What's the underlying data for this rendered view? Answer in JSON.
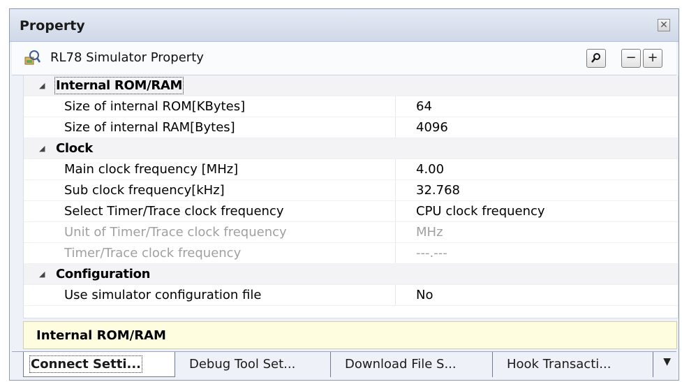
{
  "window": {
    "title": "Property"
  },
  "header": {
    "title": "RL78 Simulator Property",
    "icons": [
      "property-icon",
      "search-icon",
      "collapse-icon",
      "expand-icon"
    ]
  },
  "toolbar": {
    "search_glyph": "🔍",
    "collapse_glyph": "−",
    "expand_glyph": "+"
  },
  "categories": [
    {
      "label": "Internal ROM/RAM",
      "properties": [
        {
          "name": "Size of internal ROM[KBytes]",
          "value": "64"
        },
        {
          "name": "Size of internal RAM[Bytes]",
          "value": "4096"
        }
      ]
    },
    {
      "label": "Clock",
      "properties": [
        {
          "name": "Main clock frequency [MHz]",
          "value": "4.00"
        },
        {
          "name": "Sub clock frequency[kHz]",
          "value": "32.768"
        },
        {
          "name": "Select Timer/Trace clock frequency",
          "value": "CPU clock frequency"
        },
        {
          "name": "Unit of Timer/Trace clock frequency",
          "value": "MHz"
        },
        {
          "name": "Timer/Trace clock frequency",
          "value": "---.---"
        }
      ]
    },
    {
      "label": "Configuration",
      "properties": [
        {
          "name": "Use simulator configuration file",
          "value": "No"
        }
      ]
    }
  ],
  "description": {
    "text": "Internal ROM/RAM"
  },
  "tabs": [
    {
      "label": "Connect Setti..."
    },
    {
      "label": "Debug Tool Set..."
    },
    {
      "label": "Download File S..."
    },
    {
      "label": "Hook Transacti..."
    }
  ],
  "tab_menu_glyph": "▼",
  "colors": {
    "description_bg": "#fffde0",
    "disabled_text": "#a0a0a0",
    "titlebar": "#cfd8e8"
  }
}
